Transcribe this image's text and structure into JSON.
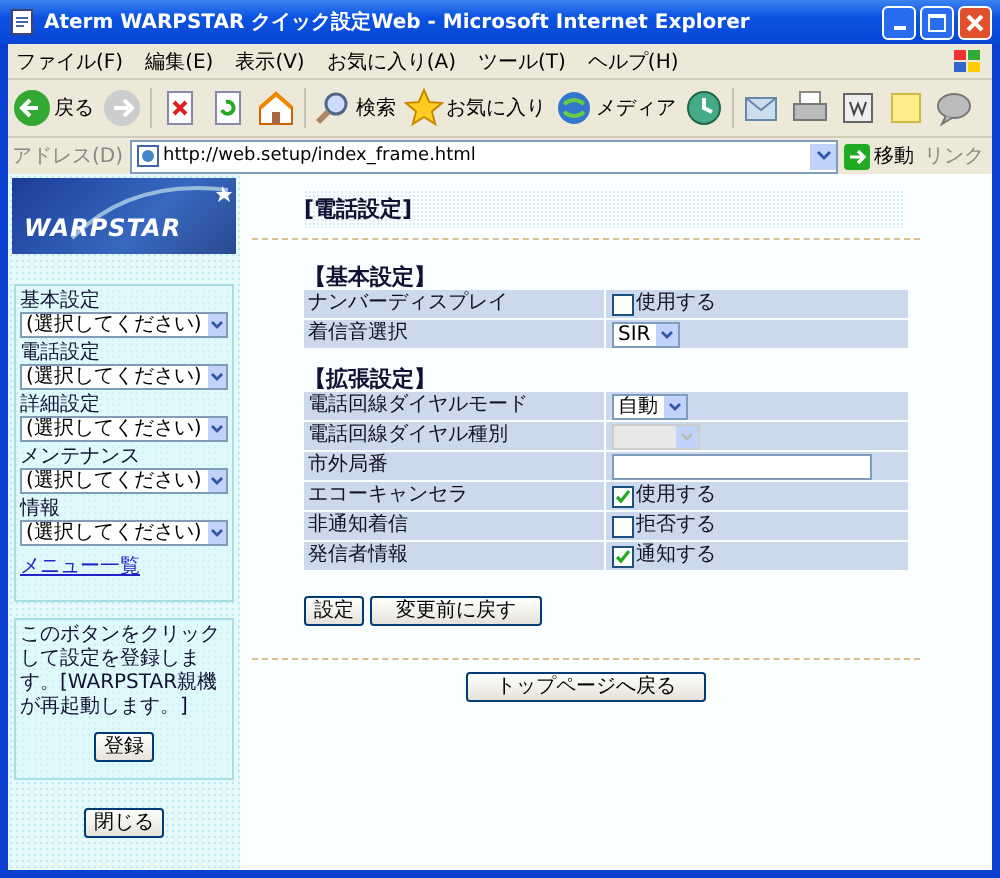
{
  "window": {
    "title": "Aterm WARPSTAR クイック設定Web - Microsoft Internet Explorer"
  },
  "menu": [
    "ファイル(F)",
    "編集(E)",
    "表示(V)",
    "お気に入り(A)",
    "ツール(T)",
    "ヘルプ(H)"
  ],
  "toolbar": [
    {
      "kind": "back",
      "label": "戻る"
    },
    {
      "kind": "forward"
    },
    {
      "kind": "stop"
    },
    {
      "kind": "refresh"
    },
    {
      "kind": "home"
    },
    {
      "kind": "search",
      "label": "検索"
    },
    {
      "kind": "favorites",
      "label": "お気に入り"
    },
    {
      "kind": "media",
      "label": "メディア"
    },
    {
      "kind": "history"
    },
    {
      "kind": "mail"
    },
    {
      "kind": "print"
    },
    {
      "kind": "edit"
    },
    {
      "kind": "note"
    },
    {
      "kind": "messenger"
    }
  ],
  "address": {
    "label": "アドレス(D)",
    "url": "http://web.setup/index_frame.html",
    "go": "移動",
    "links": "リンク"
  },
  "sidebar": {
    "logo": "WARPSTAR",
    "menus": [
      {
        "label": "基本設定",
        "value": "(選択してください)"
      },
      {
        "label": "電話設定",
        "value": "(選択してください)"
      },
      {
        "label": "詳細設定",
        "value": "(選択してください)"
      },
      {
        "label": "メンテナンス",
        "value": "(選択してください)"
      },
      {
        "label": "情報",
        "value": "(選択してください)"
      }
    ],
    "menu_link": "メニュー一覧",
    "note": "このボタンをクリックして設定を登録します。[WARPSTAR親機が再起動します。]",
    "register_button": "登録",
    "close_button": "閉じる"
  },
  "main": {
    "title": "[電話設定]",
    "sections": [
      {
        "heading": "【基本設定】",
        "rows": [
          {
            "label": "ナンバーディスプレイ",
            "kind": "checkbox",
            "checked": false,
            "text": "使用する"
          },
          {
            "label": "着信音選択",
            "kind": "select",
            "value": "SIR",
            "disabled": false
          }
        ]
      },
      {
        "heading": "【拡張設定】",
        "rows": [
          {
            "label": "電話回線ダイヤルモード",
            "kind": "select",
            "value": "自動",
            "disabled": false
          },
          {
            "label": "電話回線ダイヤル種別",
            "kind": "select",
            "disabled": true
          },
          {
            "label": "市外局番",
            "kind": "text"
          },
          {
            "label": "エコーキャンセラ",
            "kind": "checkbox",
            "checked": true,
            "text": "使用する"
          },
          {
            "label": "非通知着信",
            "kind": "checkbox",
            "checked": false,
            "text": "拒否する"
          },
          {
            "label": "発信者情報",
            "kind": "checkbox",
            "checked": true,
            "text": "通知する"
          }
        ]
      }
    ],
    "buttons": [
      "設定",
      "変更前に戻す"
    ],
    "top_button": "トップページへ戻る"
  }
}
